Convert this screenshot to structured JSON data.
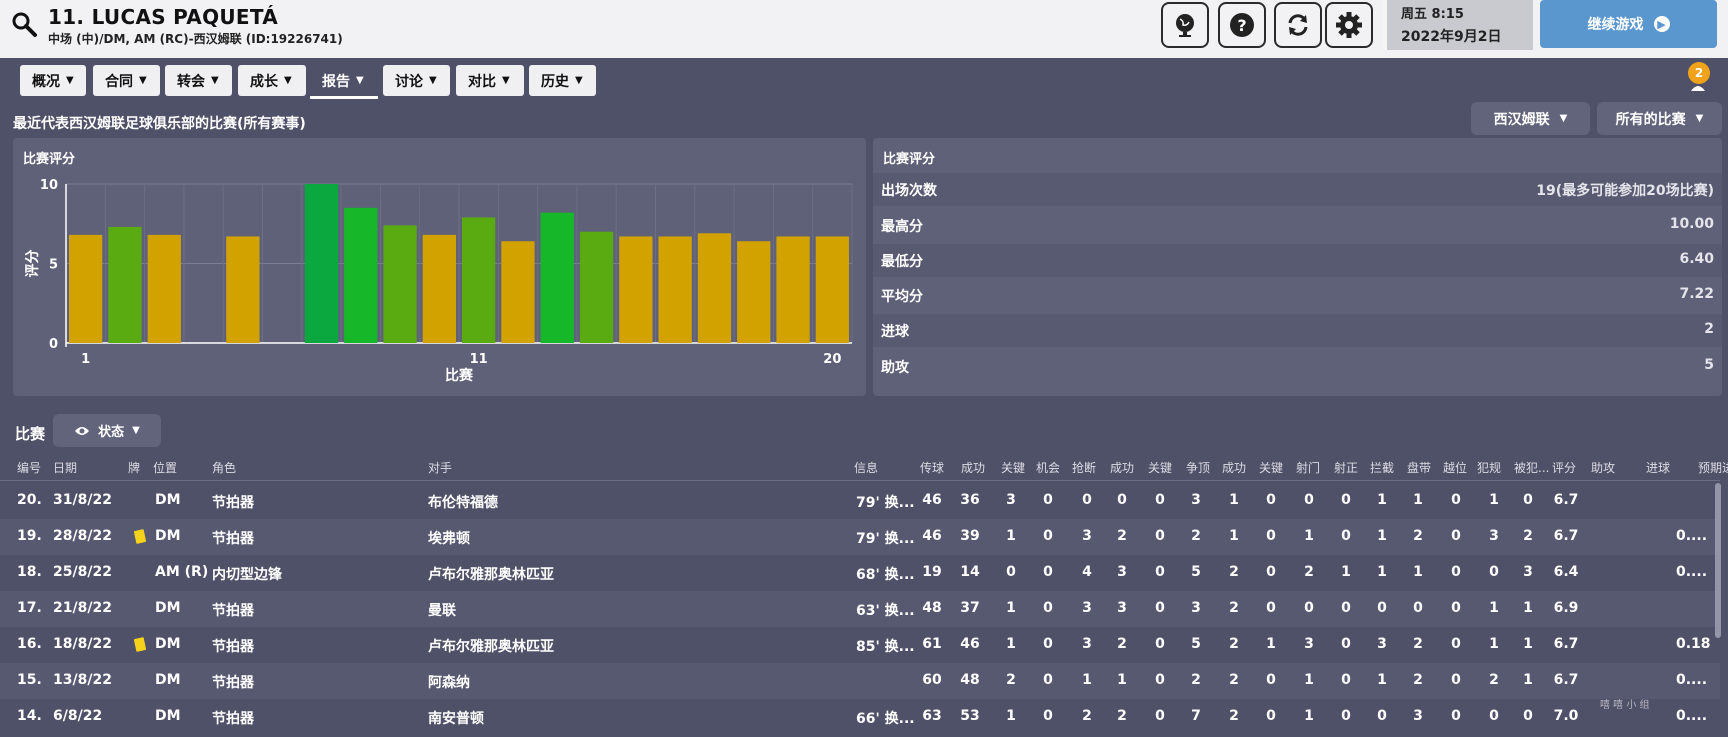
{
  "header": {
    "player_name": "11. LUCAS PAQUETÁ",
    "player_sub": "中场 (中)/DM, AM (RC)-西汉姆联 (ID:19226741)",
    "date_line1": "周五 8:15",
    "date_line2": "2022年9月2日",
    "continue_label": "继续游戏",
    "icons": [
      "search-icon",
      "globe-icon",
      "help-icon",
      "refresh-icon",
      "settings-icon"
    ]
  },
  "tabs": [
    {
      "label": "概况"
    },
    {
      "label": "合同"
    },
    {
      "label": "转会"
    },
    {
      "label": "成长"
    },
    {
      "label": "报告",
      "active": true
    },
    {
      "label": "讨论"
    },
    {
      "label": "对比"
    },
    {
      "label": "历史"
    }
  ],
  "notification_count": "2",
  "section_title": "最近代表西汉姆联足球俱乐部的比赛(所有赛事)",
  "filters": {
    "club": "西汉姆联",
    "competition": "所有的比赛"
  },
  "chart_panel": {
    "title": "比赛评分"
  },
  "chart_data": {
    "type": "bar",
    "title": "",
    "xlabel": "比赛",
    "ylabel": "评分",
    "ylim": [
      0,
      10
    ],
    "yticks": [
      "0",
      "5",
      "10"
    ],
    "xticks": [
      {
        "at": 1,
        "label": "1"
      },
      {
        "at": 11,
        "label": "11"
      },
      {
        "at": 20,
        "label": "20"
      }
    ],
    "categories": [
      1,
      2,
      3,
      4,
      5,
      6,
      7,
      8,
      9,
      10,
      11,
      12,
      13,
      14,
      15,
      16,
      17,
      18,
      19,
      20
    ],
    "values": [
      6.8,
      7.3,
      6.8,
      null,
      6.7,
      null,
      10.0,
      8.5,
      7.4,
      6.8,
      7.9,
      6.4,
      8.2,
      7.0,
      6.7,
      6.7,
      6.9,
      6.4,
      6.7,
      6.7
    ],
    "colors": {
      "low": "#d2a200",
      "mid": "#5aaa12",
      "high": "#16b82a",
      "top": "#0aa83e"
    }
  },
  "stats_panel": {
    "title": "比赛评分",
    "rows": [
      {
        "label": "出场次数",
        "value": "19(最多可能参加20场比赛)"
      },
      {
        "label": "最高分",
        "value": "10.00"
      },
      {
        "label": "最低分",
        "value": "6.40"
      },
      {
        "label": "平均分",
        "value": "7.22"
      },
      {
        "label": "进球",
        "value": "2"
      },
      {
        "label": "助攻",
        "value": "5"
      }
    ]
  },
  "matches": {
    "label": "比赛",
    "status_button": "状态",
    "columns": [
      "编号",
      "日期",
      "牌",
      "位置",
      "角色",
      "对手",
      "信息",
      "传球",
      "成功",
      "关键",
      "机会",
      "抢断",
      "成功",
      "关键",
      "争顶",
      "成功",
      "关键",
      "射门",
      "射正",
      "拦截",
      "盘带",
      "越位",
      "犯规",
      "被犯...",
      "评分",
      "助攻",
      "进球",
      "预期进..."
    ],
    "rows": [
      {
        "no": "20.",
        "date": "31/8/22",
        "card": false,
        "pos": "DM",
        "role": "节拍器",
        "opp": "布伦特福德",
        "info": "79' 换...",
        "stats": [
          "46",
          "36",
          "3",
          "0",
          "0",
          "0",
          "0",
          "3",
          "1",
          "0",
          "0",
          "0",
          "1",
          "1",
          "0",
          "1",
          "0",
          "6.7"
        ],
        "xg": ""
      },
      {
        "no": "19.",
        "date": "28/8/22",
        "card": true,
        "pos": "DM",
        "role": "节拍器",
        "opp": "埃弗顿",
        "info": "79' 换...",
        "stats": [
          "46",
          "39",
          "1",
          "0",
          "3",
          "2",
          "0",
          "2",
          "1",
          "0",
          "1",
          "0",
          "1",
          "2",
          "0",
          "3",
          "2",
          "6.7"
        ],
        "xg": "0...."
      },
      {
        "no": "18.",
        "date": "25/8/22",
        "card": false,
        "pos": "AM (R)",
        "role": "内切型边锋",
        "opp": "卢布尔雅那奥林匹亚",
        "info": "68' 换...",
        "stats": [
          "19",
          "14",
          "0",
          "0",
          "4",
          "3",
          "0",
          "5",
          "2",
          "0",
          "2",
          "1",
          "1",
          "1",
          "0",
          "0",
          "3",
          "6.4"
        ],
        "xg": "0...."
      },
      {
        "no": "17.",
        "date": "21/8/22",
        "card": false,
        "pos": "DM",
        "role": "节拍器",
        "opp": "曼联",
        "info": "63' 换...",
        "stats": [
          "48",
          "37",
          "1",
          "0",
          "3",
          "3",
          "0",
          "3",
          "2",
          "0",
          "0",
          "0",
          "0",
          "0",
          "0",
          "1",
          "1",
          "6.9"
        ],
        "xg": ""
      },
      {
        "no": "16.",
        "date": "18/8/22",
        "card": true,
        "pos": "DM",
        "role": "节拍器",
        "opp": "卢布尔雅那奥林匹亚",
        "info": "85' 换...",
        "stats": [
          "61",
          "46",
          "1",
          "0",
          "3",
          "2",
          "0",
          "5",
          "2",
          "1",
          "3",
          "0",
          "3",
          "2",
          "0",
          "1",
          "1",
          "6.7"
        ],
        "xg": "0.18"
      },
      {
        "no": "15.",
        "date": "13/8/22",
        "card": false,
        "pos": "DM",
        "role": "节拍器",
        "opp": "阿森纳",
        "info": "",
        "stats": [
          "60",
          "48",
          "2",
          "0",
          "1",
          "1",
          "0",
          "2",
          "2",
          "0",
          "1",
          "0",
          "1",
          "2",
          "0",
          "2",
          "1",
          "6.7"
        ],
        "xg": "0...."
      },
      {
        "no": "14.",
        "date": "6/8/22",
        "card": false,
        "pos": "DM",
        "role": "节拍器",
        "opp": "南安普顿",
        "info": "66' 换...",
        "stats": [
          "63",
          "53",
          "1",
          "0",
          "2",
          "2",
          "0",
          "7",
          "2",
          "0",
          "1",
          "0",
          "0",
          "3",
          "0",
          "0",
          "0",
          "7.0"
        ],
        "xg": "0...."
      }
    ]
  },
  "watermark": "嘻 嘻 小 组"
}
